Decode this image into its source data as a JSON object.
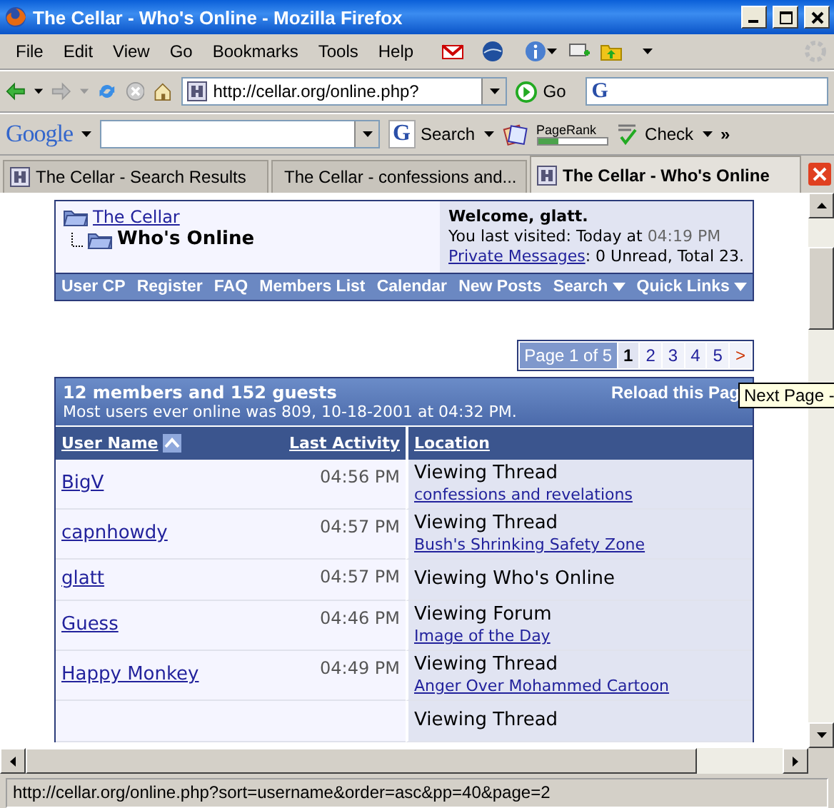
{
  "window": {
    "title": "The Cellar - Who's Online - Mozilla Firefox"
  },
  "menu": [
    {
      "label": "File"
    },
    {
      "label": "Edit"
    },
    {
      "label": "View"
    },
    {
      "label": "Go"
    },
    {
      "label": "Bookmarks"
    },
    {
      "label": "Tools"
    },
    {
      "label": "Help"
    }
  ],
  "navigation": {
    "url": "http://cellar.org/online.php?",
    "go_label": "Go"
  },
  "search_field_icon": "G",
  "google_toolbar": {
    "logo": "Google",
    "search_icon": "G",
    "search_label": "Search",
    "pagerank_label": "PageRank",
    "pagerank": {
      "level": 0.3
    },
    "check_label": "Check",
    "overflow": "»"
  },
  "tabs": [
    {
      "label": "The Cellar - Search Results",
      "selected": false
    },
    {
      "label": "The Cellar - confessions and...",
      "selected": false
    },
    {
      "label": "The Cellar - Who's Online",
      "selected": true
    }
  ],
  "page": {
    "breadcrumb": {
      "root": "The Cellar",
      "current": "Who's Online"
    },
    "welcome": {
      "greeting": "Welcome, glatt.",
      "last_visited": "You last visited: Today at",
      "last_visited_time": "04:19 PM",
      "pm_link": "Private Messages",
      "pm_status": ": 0 Unread, Total 23."
    },
    "navbar": [
      {
        "label": "User CP",
        "dropdown": false
      },
      {
        "label": "Register",
        "dropdown": false
      },
      {
        "label": "FAQ",
        "dropdown": false
      },
      {
        "label": "Members List",
        "dropdown": false
      },
      {
        "label": "Calendar",
        "dropdown": false
      },
      {
        "label": "New Posts",
        "dropdown": false
      },
      {
        "label": "Search",
        "dropdown": true
      },
      {
        "label": "Quick Links",
        "dropdown": true
      }
    ],
    "pagination": {
      "label": "Page 1 of 5",
      "pages": [
        {
          "label": "1",
          "selected": true
        },
        {
          "label": "2",
          "selected": false
        },
        {
          "label": "3",
          "selected": false
        },
        {
          "label": "4",
          "selected": false
        },
        {
          "label": "5",
          "selected": false
        }
      ],
      "next": ">"
    },
    "online_table": {
      "summary": "12 members and 152 guests",
      "record": "Most users ever online was 809, 10-18-2001 at 04:32 PM.",
      "reload": "Reload this Pag",
      "columns": [
        "User Name",
        "Last Activity",
        "Location"
      ],
      "rows": [
        {
          "user": "BigV",
          "time": "04:56 PM",
          "action": "Viewing Thread",
          "link": "confessions and revelations"
        },
        {
          "user": "capnhowdy",
          "time": "04:57 PM",
          "action": "Viewing Thread",
          "link": "Bush's Shrinking Safety Zone"
        },
        {
          "user": "glatt",
          "time": "04:57 PM",
          "action": "Viewing Who's Online"
        },
        {
          "user": "Guess",
          "time": "04:46 PM",
          "action": "Viewing Forum",
          "link": "Image of the Day"
        },
        {
          "user": "Happy Monkey",
          "time": "04:49 PM",
          "action": "Viewing Thread",
          "link": "Anger Over Mohammed Cartoon"
        },
        {
          "action": "Viewing Thread"
        }
      ]
    }
  },
  "tooltip": "Next Page -",
  "status_bar": {
    "text": "http://cellar.org/online.php?sort=username&order=asc&pp=40&page=2"
  }
}
